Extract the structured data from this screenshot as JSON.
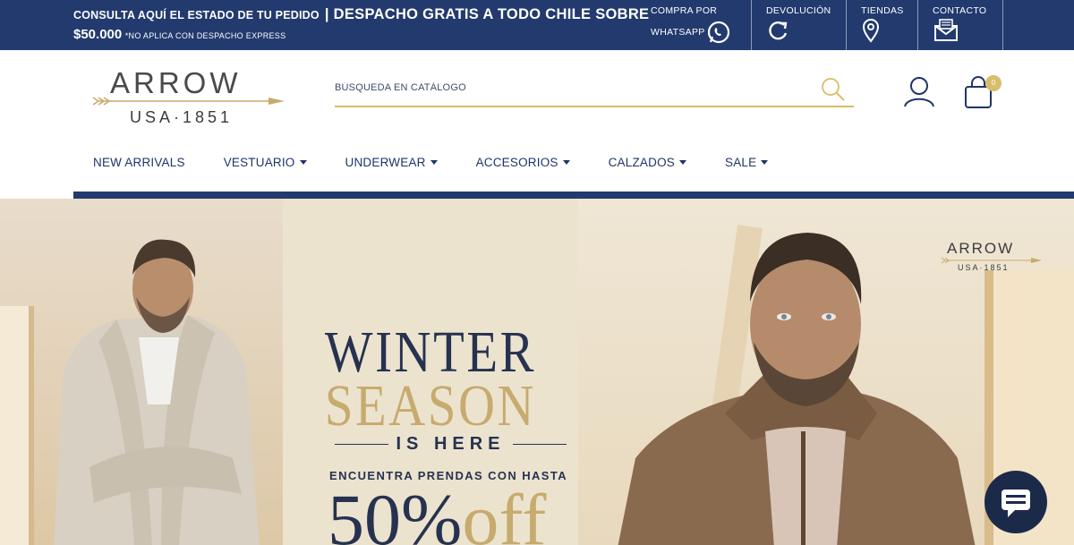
{
  "topbar": {
    "promo_line1": "CONSULTA AQUÍ EL ESTADO DE TU PEDIDO",
    "promo_line1_big": "| DESPACHO GRATIS A TODO CHILE SOBRE",
    "promo_amount": "$50.000",
    "promo_note": "*NO APLICA CON DESPACHO EXPRESS",
    "links": [
      {
        "label": "COMPRA POR",
        "label2": "WHATSAPP",
        "icon": "whatsapp-icon"
      },
      {
        "label": "DEVOLUCIÓN",
        "icon": "refresh-icon"
      },
      {
        "label": "TIENDAS",
        "icon": "location-pin-icon"
      },
      {
        "label": "CONTACTO",
        "icon": "mail-icon"
      }
    ],
    "colors": {
      "bg": "#223a6e"
    }
  },
  "header": {
    "logo_word": "ARROW",
    "logo_sub": "USA·1851",
    "search_placeholder": "BÚSQUEDA EN CATÁLOGO",
    "cart_count": "0",
    "accent": "#d8be6a"
  },
  "nav": {
    "items": [
      {
        "label": "NEW ARRIVALS",
        "dropdown": false
      },
      {
        "label": "VESTUARIO",
        "dropdown": true
      },
      {
        "label": "UNDERWEAR",
        "dropdown": true
      },
      {
        "label": "ACCESORIOS",
        "dropdown": true
      },
      {
        "label": "CALZADOS",
        "dropdown": true
      },
      {
        "label": "SALE",
        "dropdown": true
      }
    ]
  },
  "hero": {
    "line1": "WINTER",
    "line2": "SEASON",
    "line3": "IS HERE",
    "line4": "ENCUENTRA PRENDAS CON HASTA",
    "discount_num": "50%",
    "discount_word": "off",
    "brand_word": "ARROW",
    "brand_sub": "USA·1851",
    "colors": {
      "navy": "#26324f",
      "gold": "#c7ab6e"
    }
  },
  "chat": {
    "icon": "chat-bubble-icon"
  }
}
